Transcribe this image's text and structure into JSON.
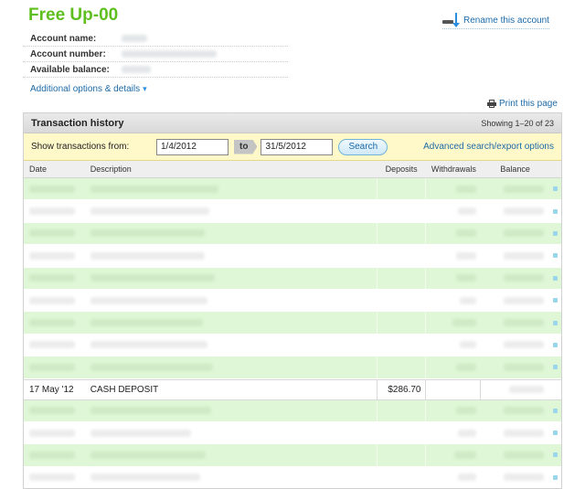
{
  "header": {
    "title": "Free Up-00",
    "rename_label": "Rename this account"
  },
  "account": {
    "name_label": "Account name:",
    "number_label": "Account number:",
    "balance_label": "Available balance:"
  },
  "additional_options_label": "Additional options & details",
  "print_label": "Print this page",
  "transactions": {
    "title": "Transaction history",
    "showing": "Showing 1–20 of 23",
    "filter_label": "Show transactions from:",
    "date_from": "1/4/2012",
    "to_label": "to",
    "date_to": "31/5/2012",
    "search_label": "Search",
    "advanced_label": "Advanced search/export options",
    "columns": {
      "date": "Date",
      "description": "Description",
      "deposits": "Deposits",
      "withdrawals": "Withdrawals",
      "balance": "Balance"
    },
    "visible_row": {
      "date": "17 May '12",
      "description": "CASH DEPOSIT",
      "deposit": "$286.70"
    }
  },
  "colors": {
    "title_green": "#5fbf1f",
    "link_blue": "#1c6aa8",
    "row_green": "#dff7d6",
    "filter_yellow": "#fff8c9"
  },
  "icons": [
    "pen-arrow-icon",
    "chevron-double-down-icon",
    "printer-icon",
    "row-indicator-icon"
  ]
}
